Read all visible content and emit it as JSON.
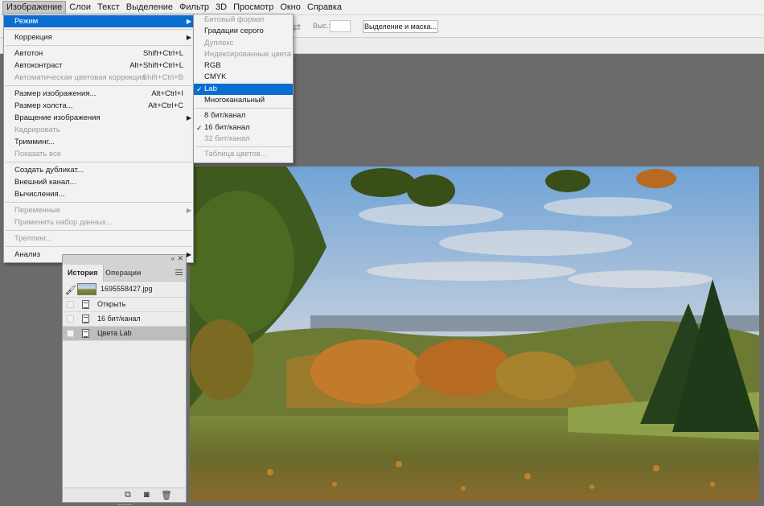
{
  "menubar": {
    "items": [
      "Изображение",
      "Слои",
      "Текст",
      "Выделение",
      "Фильтр",
      "3D",
      "Просмотр",
      "Окно",
      "Справка"
    ]
  },
  "options": {
    "height_label": "Выс.:",
    "select_mask_button": "Выделение и маска..."
  },
  "image_menu": {
    "mode": "Режим",
    "correction": "Коррекция",
    "autotone": "Автотон",
    "autotone_sc": "Shift+Ctrl+L",
    "autocontrast": "Автоконтраст",
    "autocontrast_sc": "Alt+Shift+Ctrl+L",
    "autocolor": "Автоматическая цветовая коррекция",
    "autocolor_sc": "Shift+Ctrl+B",
    "image_size": "Размер изображения...",
    "image_size_sc": "Alt+Ctrl+I",
    "canvas_size": "Размер холста...",
    "canvas_size_sc": "Alt+Ctrl+C",
    "rotation": "Вращение изображения",
    "crop": "Кадрировать",
    "trim": "Тримминг...",
    "reveal_all": "Показать все",
    "duplicate": "Создать дубликат...",
    "apply_image": "Внешний канал...",
    "calculations": "Вычисления...",
    "variables": "Переменные",
    "apply_dataset": "Применить набор данных...",
    "trap": "Треппинг...",
    "analysis": "Анализ"
  },
  "mode_menu": {
    "bitmap": "Битовый формат",
    "grayscale": "Градации серого",
    "duotone": "Дуплекс",
    "indexed": "Индексированные цвета",
    "rgb": "RGB",
    "cmyk": "CMYK",
    "lab": "Lab",
    "multichannel": "Многоканальный",
    "bits8": "8 бит/канал",
    "bits16": "16 бит/канал",
    "bits32": "32 бит/канал",
    "color_table": "Таблица цветов...",
    "checkmark": "✓"
  },
  "history_panel": {
    "tab_history": "История",
    "tab_actions": "Операции",
    "snapshot_name": "1695558427.jpg",
    "rows": [
      "Открыть",
      "16 бит/канал",
      "Цвета Lab"
    ],
    "selected_row": "Цвета Lab"
  },
  "icons": {
    "collapse": "«",
    "close": "✕",
    "brush": "🖌",
    "new_doc": "⧉",
    "camera": "◙",
    "trash": "🗑",
    "swap": "⇄",
    "submenu_arrow": "▶"
  },
  "colors": {
    "highlight": "#0a6ed1",
    "menu_bg": "#f2f2f2",
    "workspace": "#6b6b6b"
  }
}
